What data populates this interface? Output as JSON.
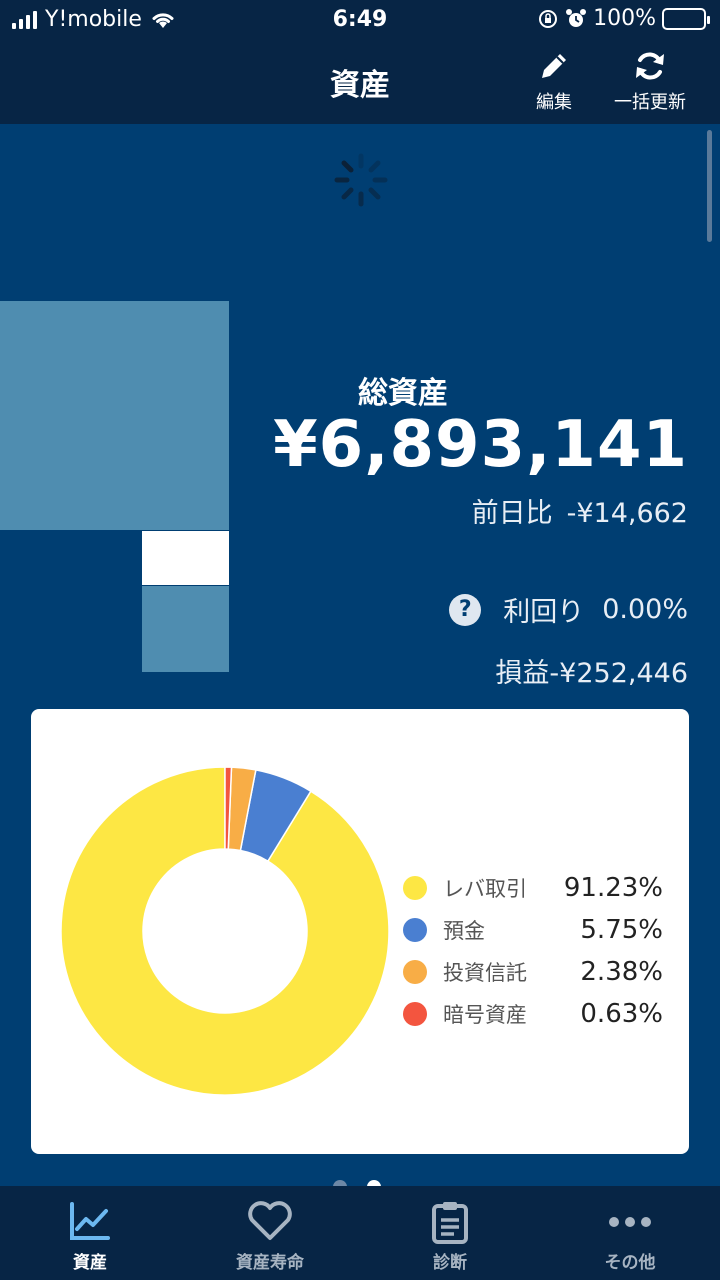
{
  "status_bar": {
    "carrier": "Y!mobile",
    "time": "6:49",
    "battery": "100%"
  },
  "header": {
    "title": "資産",
    "edit_label": "編集",
    "refresh_label": "一括更新"
  },
  "summary": {
    "total_label": "総資産",
    "total_value": "¥6,893,141",
    "day_change_label": "前日比",
    "day_change_value": "-¥14,662",
    "yield_label": "利回り",
    "yield_value": "0.00%",
    "pl_label": "損益",
    "pl_value": "-¥252,446"
  },
  "chart_data": {
    "type": "pie",
    "donut": true,
    "categories": [
      "レバ取引",
      "預金",
      "投資信託",
      "暗号資産"
    ],
    "values": [
      91.23,
      5.75,
      2.38,
      0.63
    ],
    "labels": [
      "91.23%",
      "5.75%",
      "2.38%",
      "0.63%"
    ],
    "colors": [
      "#fde744",
      "#4a7fd1",
      "#f8ad46",
      "#f3553f"
    ],
    "legend": "right"
  },
  "pager": {
    "pages": 2,
    "active": 2
  },
  "tabs": [
    {
      "label": "資産",
      "icon": "chart-line-icon",
      "active": true
    },
    {
      "label": "資産寿命",
      "icon": "heart-icon",
      "active": false
    },
    {
      "label": "診断",
      "icon": "clipboard-icon",
      "active": false
    },
    {
      "label": "その他",
      "icon": "more-dots-icon",
      "active": false
    }
  ]
}
